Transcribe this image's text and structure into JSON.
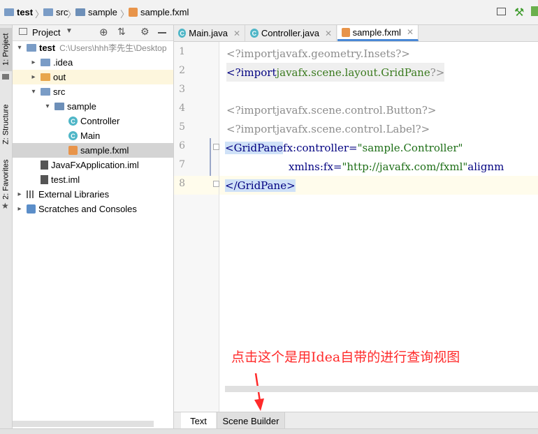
{
  "breadcrumb": [
    "test",
    "src",
    "sample",
    "sample.fxml"
  ],
  "tool_strip": {
    "project": "1: Project",
    "structure": "Z: Structure",
    "favorites": "2: Favorites"
  },
  "project_panel": {
    "title": "Project",
    "tree": [
      {
        "label": "test",
        "hint": "C:\\Users\\hhh李先生\\Desktop",
        "icon": "folder-icon",
        "depth": 0,
        "arrow": "▾"
      },
      {
        "label": ".idea",
        "icon": "folder-icon",
        "depth": 1,
        "arrow": "▸"
      },
      {
        "label": "out",
        "icon": "folder-icon",
        "depth": 1,
        "arrow": "▸"
      },
      {
        "label": "src",
        "icon": "folder-icon",
        "depth": 1,
        "arrow": "▾"
      },
      {
        "label": "sample",
        "icon": "package-icon",
        "depth": 2,
        "arrow": "▾"
      },
      {
        "label": "Controller",
        "icon": "class-icon",
        "depth": 3,
        "arrow": ""
      },
      {
        "label": "Main",
        "icon": "class-icon",
        "depth": 3,
        "arrow": ""
      },
      {
        "label": "sample.fxml",
        "icon": "fxml-icon",
        "depth": 3,
        "arrow": ""
      },
      {
        "label": "JavaFxApplication.iml",
        "icon": "file-icon",
        "depth": 1,
        "arrow": ""
      },
      {
        "label": "test.iml",
        "icon": "file-icon",
        "depth": 1,
        "arrow": ""
      },
      {
        "label": "External Libraries",
        "icon": "library-icon",
        "depth": 0,
        "arrow": "▸"
      },
      {
        "label": "Scratches and Consoles",
        "icon": "scratch-icon",
        "depth": 0,
        "arrow": "▸"
      }
    ]
  },
  "editor_tabs": [
    {
      "label": "Main.java",
      "active": false
    },
    {
      "label": "Controller.java",
      "active": false
    },
    {
      "label": "sample.fxml",
      "active": true
    }
  ],
  "code": {
    "line_numbers": [
      "1",
      "2",
      "3",
      "4",
      "5",
      "6",
      "7",
      "8"
    ],
    "l1": {
      "open": "<?",
      "kw": "import",
      "pkg": "javafx.geometry.Insets",
      "close": "?>"
    },
    "l2": {
      "open": "<?",
      "kw": "import",
      "pkg": "javafx.scene.layout.GridPane",
      "close": "?>"
    },
    "l4": {
      "open": "<?",
      "kw": "import",
      "pkg": "javafx.scene.control.Button",
      "close": "?>"
    },
    "l5": {
      "open": "<?",
      "kw": "import",
      "pkg": "javafx.scene.control.Label",
      "close": "?>"
    },
    "l6": {
      "tag": "<GridPane",
      "attr": "fx:controller=",
      "val": "\"sample.Controller\""
    },
    "l7": {
      "attr": "xmlns:fx=",
      "val": "\"http://javafx.com/fxml\"",
      "attr2": "alignm"
    },
    "l8": {
      "tag": "</GridPane>"
    }
  },
  "annotation": "点击这个是用Idea自带的进行查询视图",
  "bottom_tabs": [
    "Text",
    "Scene Builder"
  ],
  "colors": {
    "annotation": "#ff2a2a",
    "keyword": "#000080",
    "string": "#1d6e16",
    "package": "#3a7a1e"
  }
}
